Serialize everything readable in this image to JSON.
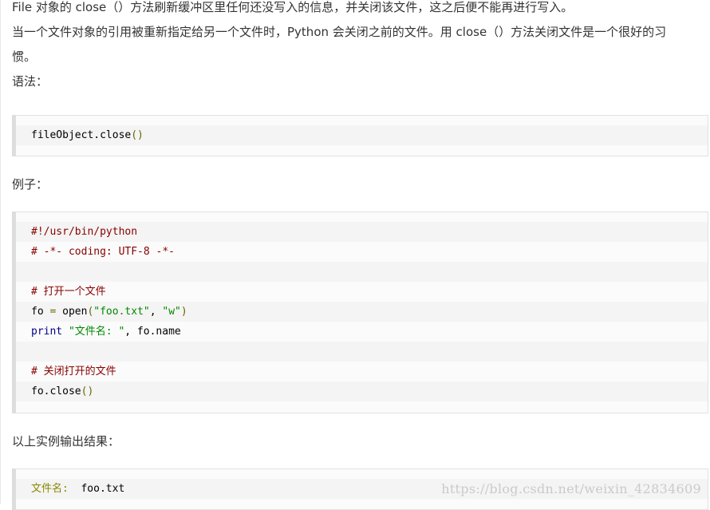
{
  "intro": {
    "line1": "File 对象的 close（）方法刷新缓冲区里任何还没写入的信息，并关闭该文件，这之后便不能再进行写入。",
    "line2": "当一个文件对象的引用被重新指定给另一个文件时，Python 会关闭之前的文件。用 close（）方法关闭文件是一个很好的习",
    "line3": "惯。"
  },
  "syntax": {
    "heading": "语法：",
    "code": [
      "fileObject.close",
      "()"
    ]
  },
  "example": {
    "heading": "例子：",
    "lines": [
      "#!/usr/bin/python",
      "# -*- coding: UTF-8 -*-",
      "",
      "# 打开一个文件",
      "fo",
      " = ",
      "open",
      "(",
      "\"foo.txt\"",
      ", ",
      "\"w\"",
      ")",
      "print",
      " \"文件名: \"",
      ", fo.name",
      "",
      "# 关闭打开的文件",
      "fo.close",
      "()"
    ]
  },
  "output": {
    "heading": "以上实例输出结果：",
    "label": "文件名:",
    "value": "  foo.txt"
  },
  "watermark": "https://blog.csdn.net/weixin_42834609"
}
